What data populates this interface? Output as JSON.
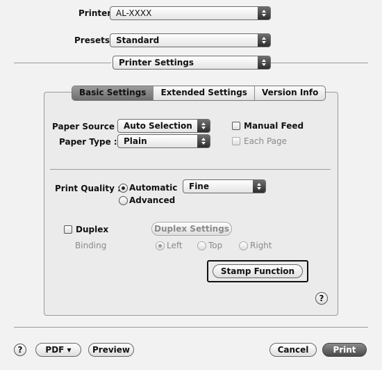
{
  "header": {
    "printer_label": "Printer:",
    "printer_value": "AL-XXXX",
    "presets_label": "Presets:",
    "presets_value": "Standard",
    "section_value": "Printer Settings"
  },
  "tabs": [
    {
      "label": "Basic Settings",
      "active": true
    },
    {
      "label": "Extended Settings",
      "active": false
    },
    {
      "label": "Version Info",
      "active": false
    }
  ],
  "paper": {
    "source_label": "Paper Source :",
    "source_value": "Auto Selection",
    "type_label": "Paper Type :",
    "type_value": "Plain",
    "manual_feed_label": "Manual Feed",
    "each_page_label": "Each Page"
  },
  "quality": {
    "label": "Print Quality :",
    "automatic_label": "Automatic",
    "automatic_value": "Fine",
    "advanced_label": "Advanced"
  },
  "duplex": {
    "label": "Duplex",
    "settings_button": "Duplex Settings",
    "binding_label": "Binding",
    "left_label": "Left",
    "top_label": "Top",
    "right_label": "Right"
  },
  "stamp_button": "Stamp Function",
  "help_glyph": "?",
  "footer": {
    "pdf_label": "PDF ▾",
    "preview_label": "Preview",
    "cancel_label": "Cancel",
    "print_label": "Print"
  },
  "icons": {
    "popup_arrows": "up-down-arrows-icon",
    "help": "question-mark-icon"
  }
}
